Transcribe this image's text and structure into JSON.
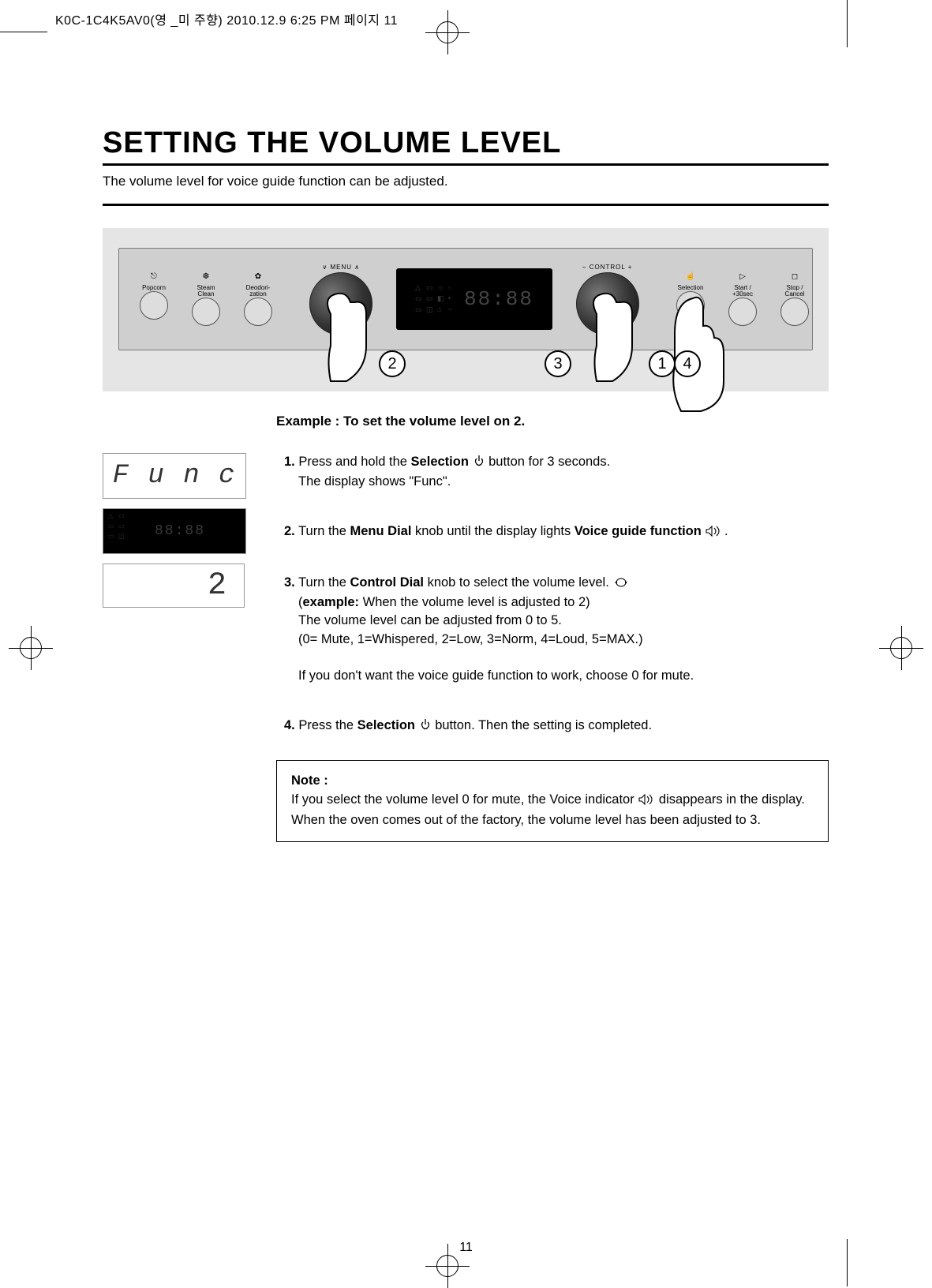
{
  "meta": {
    "header": "K0C-1C4K5AV0(영 _미 주향)  2010.12.9  6:25 PM 페이지 11",
    "page_number": "11"
  },
  "title": "SETTING THE VOLUME LEVEL",
  "subtitle": "The volume level for voice guide function can be adjusted.",
  "panel": {
    "left_buttons": [
      {
        "icon": "⎋",
        "label": "Popcorn"
      },
      {
        "icon": "",
        "label": "Steam\nClean"
      },
      {
        "icon": "",
        "label": "Deodori-\nzation"
      }
    ],
    "menu_label": "∨  MENU  ∧",
    "control_label": "–  CONTROL  +",
    "right_buttons": [
      {
        "icon": "☝",
        "label": "Selection"
      },
      {
        "icon": "",
        "label": "Start /\n+30sec"
      },
      {
        "icon": "",
        "label": "Stop /\nCancel"
      }
    ],
    "display_seg": "88:88",
    "callouts": {
      "c1": "1",
      "c2": "2",
      "c3": "3",
      "c4": "4"
    }
  },
  "example_title": "Example : To set the volume level on 2.",
  "mini": {
    "func": "F u  n c",
    "seg": "88:88",
    "two": "2"
  },
  "steps": {
    "s1_num": "1.",
    "s1_a": "Press and hold the ",
    "s1_bold": "Selection",
    "s1_b": "  button for 3 seconds.",
    "s1_c": "The display shows \"Func\".",
    "s2_num": "2.",
    "s2_a": "Turn the ",
    "s2_bold": "Menu Dial",
    "s2_b": " knob until the display lights ",
    "s2_bold2": "Voice guide function",
    "s2_c": " .",
    "s3_num": "3.",
    "s3_a": "Turn the ",
    "s3_bold": "Control Dial",
    "s3_b": " knob   to select the volume level.",
    "s3_c": "(",
    "s3_bold2": "example:",
    "s3_d": " When the volume level is adjusted to 2)",
    "s3_e": "The volume level can be adjusted from 0 to 5.",
    "s3_f": "(0= Mute, 1=Whispered, 2=Low, 3=Norm, 4=Loud, 5=MAX.)",
    "s3_g": "If you don't want the voice guide function to work, choose 0 for mute.",
    "s4_num": "4.",
    "s4_a": "Press the ",
    "s4_bold": "Selection",
    "s4_b": "  button. Then the setting is completed."
  },
  "note": {
    "title": "Note :",
    "l1a": "If you select the volume level 0 for mute, the Voice indicator ",
    "l1b": " disappears in the display.",
    "l2": "When the oven comes out of the factory, the volume level has been adjusted to 3."
  }
}
